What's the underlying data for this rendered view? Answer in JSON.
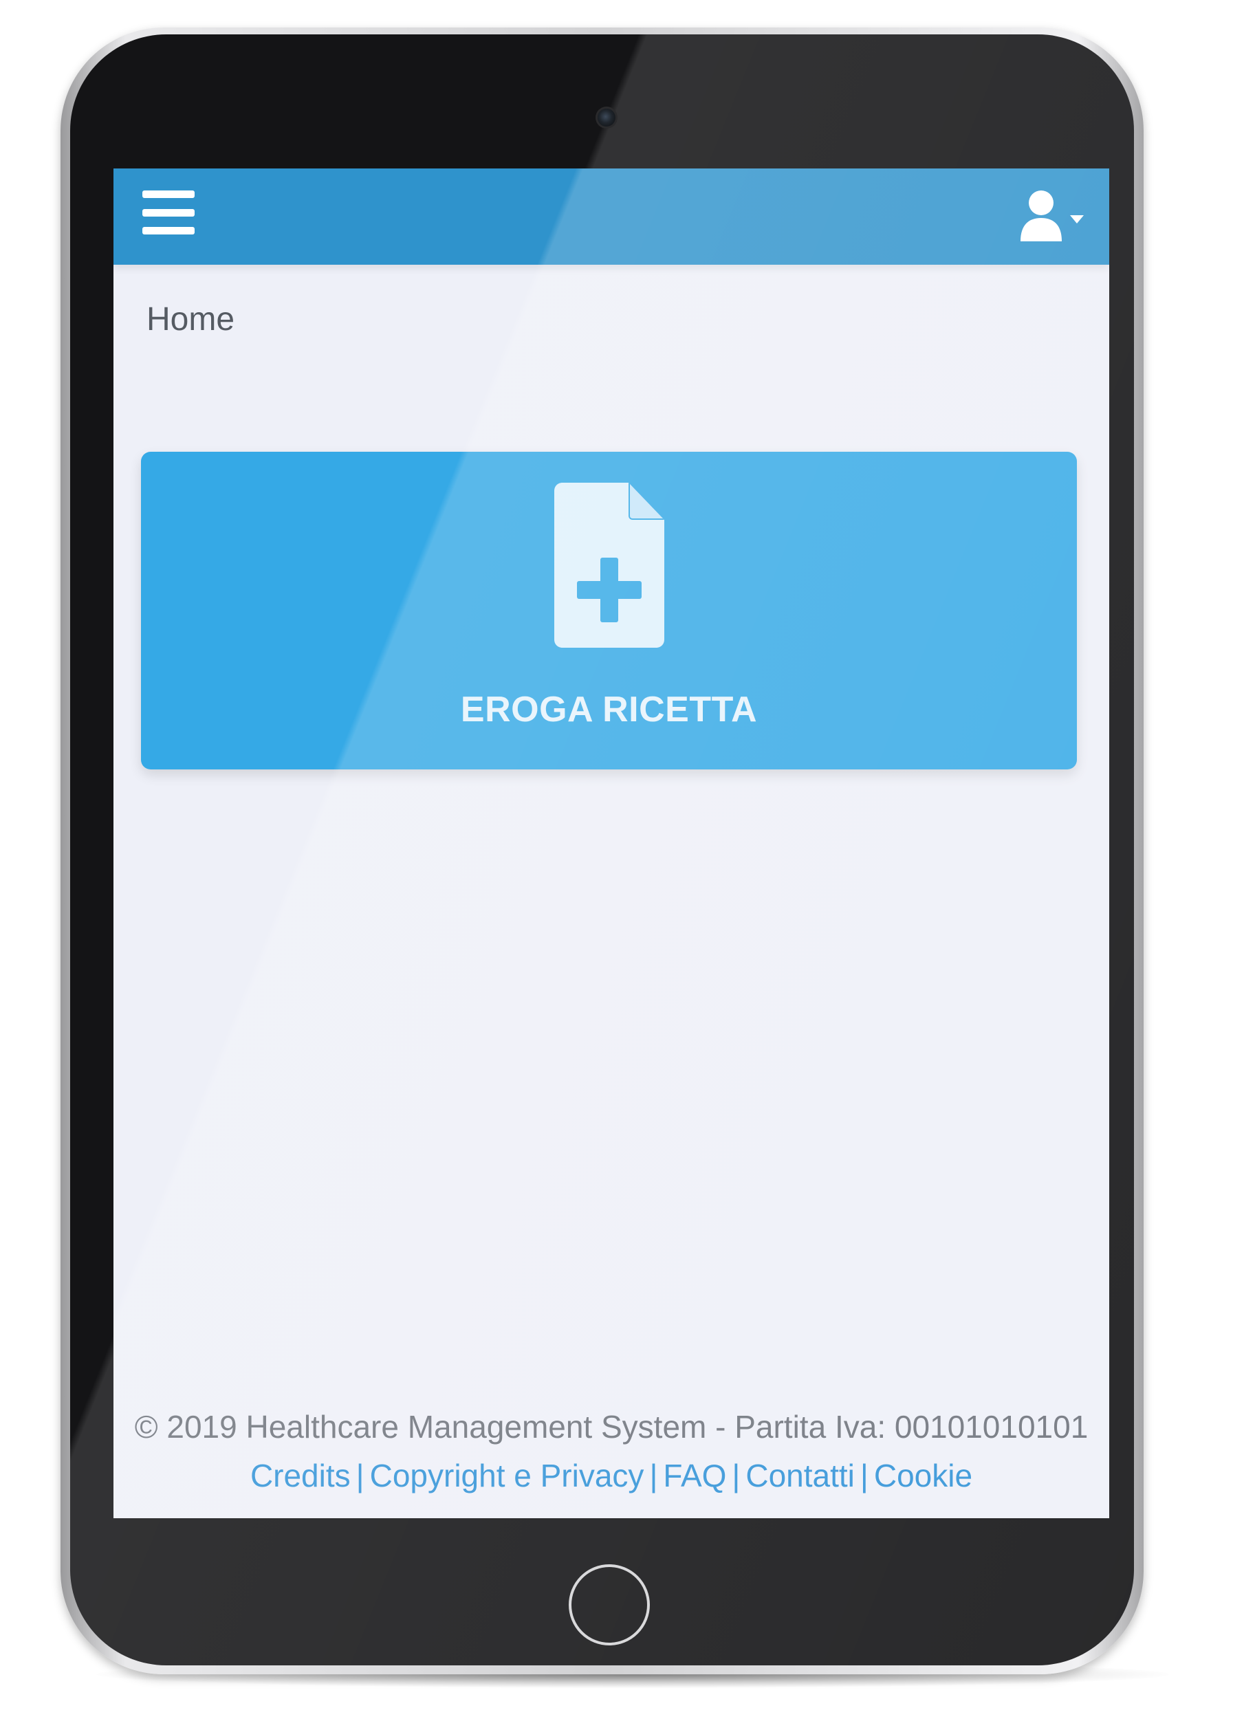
{
  "header": {
    "menu_icon": "hamburger-menu-icon",
    "user_icon": "user-icon",
    "dropdown_icon": "caret-down-icon",
    "color": "#2f93cc"
  },
  "breadcrumb": {
    "label": "Home"
  },
  "main": {
    "card": {
      "icon": "prescription-document-icon",
      "label": "EROGA RICETTA",
      "color": "#35a9e6"
    }
  },
  "footer": {
    "copyright": "© 2019 Healthcare Management System - Partita Iva: 00101010101",
    "links": [
      "Credits",
      "Copyright e Privacy",
      "FAQ",
      "Contatti",
      "Cookie"
    ],
    "link_color": "#2a8fd6"
  }
}
